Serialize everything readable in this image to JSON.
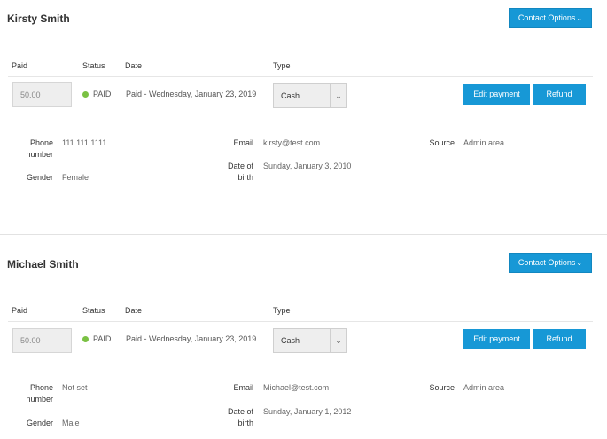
{
  "contacts": [
    {
      "name": "Kirsty Smith",
      "contact_options_label": "Contact Options",
      "headers": {
        "paid": "Paid",
        "status": "Status",
        "date": "Date",
        "type": "Type"
      },
      "paid_value": "50.00",
      "status": "PAID",
      "date": "Paid - Wednesday, January 23, 2019",
      "type": "Cash",
      "edit_payment_label": "Edit payment",
      "refund_label": "Refund",
      "fields": {
        "phone_label_1": "Phone",
        "phone_label_2": "number",
        "phone": "111 111 1111",
        "email_label": "Email",
        "email": "kirsty@test.com",
        "source_label": "Source",
        "source": "Admin area",
        "gender_label": "Gender",
        "gender": "Female",
        "dob_label_1": "Date of",
        "dob_label_2": "birth",
        "dob": "Sunday, January 3, 2010"
      }
    },
    {
      "name": "Michael Smith",
      "contact_options_label": "Contact Options",
      "headers": {
        "paid": "Paid",
        "status": "Status",
        "date": "Date",
        "type": "Type"
      },
      "paid_value": "50.00",
      "status": "PAID",
      "date": "Paid - Wednesday, January 23, 2019",
      "type": "Cash",
      "edit_payment_label": "Edit payment",
      "refund_label": "Refund",
      "fields": {
        "phone_label_1": "Phone",
        "phone_label_2": "number",
        "phone": "Not set",
        "email_label": "Email",
        "email": "Michael@test.com",
        "source_label": "Source",
        "source": "Admin area",
        "gender_label": "Gender",
        "gender": "Male",
        "dob_label_1": "Date of",
        "dob_label_2": "birth",
        "dob": "Sunday, January 1, 2012"
      }
    }
  ],
  "icons": {
    "contact_options_chevron": "chevron-down-icon",
    "type_select_chevron": "chevron-down-icon",
    "status_dot": "status-dot-icon"
  },
  "colors": {
    "accent": "#1798d6",
    "status_paid": "#7ac143",
    "input_bg": "#eeeeee"
  }
}
